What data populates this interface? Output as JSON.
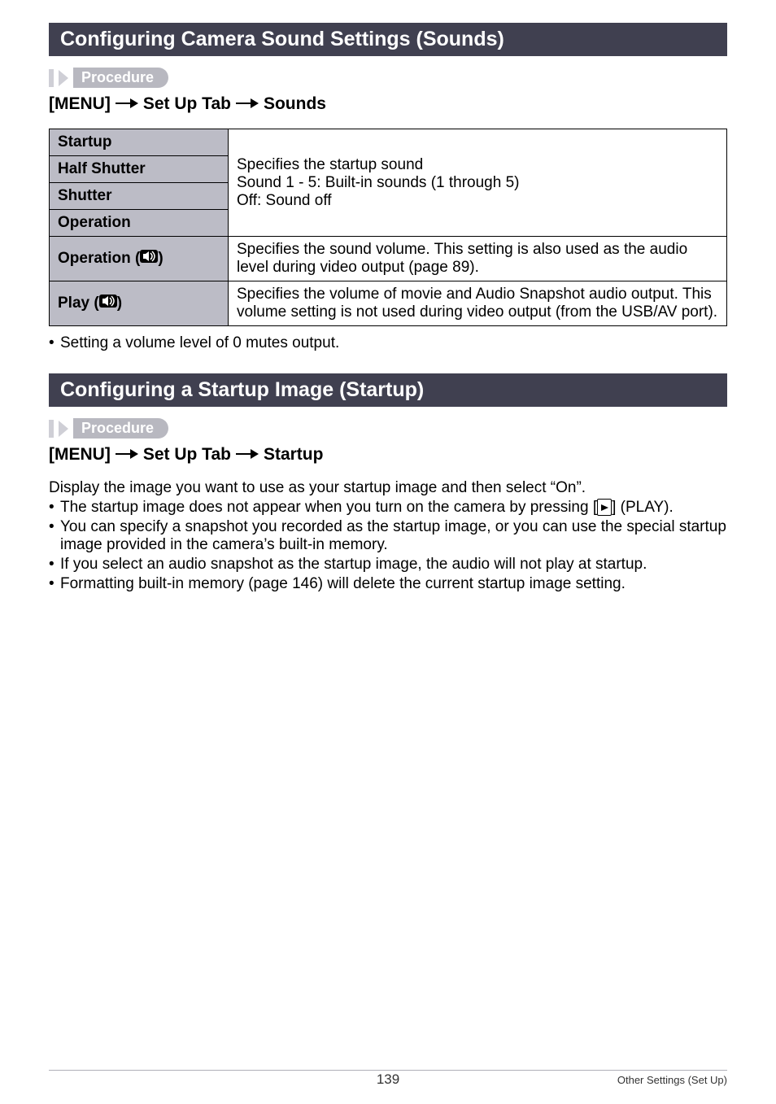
{
  "section1": {
    "title": "Configuring Camera Sound Settings (Sounds)",
    "procedure_label": "Procedure",
    "menu_path": {
      "p1": "[MENU]",
      "p2": "Set Up Tab",
      "p3": "Sounds"
    },
    "table": {
      "rows": [
        {
          "label": "Startup"
        },
        {
          "label": "Half Shutter"
        },
        {
          "label": "Shutter"
        },
        {
          "label": "Operation"
        }
      ],
      "desc_l1": "Specifies the startup sound",
      "desc_l2": "Sound 1 - 5: Built-in sounds (1 through 5)",
      "desc_l3": "Off: Sound off",
      "op_vol_label_pre": "Operation (",
      "op_vol_label_post": ")",
      "op_vol_desc": "Specifies the sound volume. This setting is also used as the audio level during video output (page 89).",
      "play_label_pre": "Play (",
      "play_label_post": ")",
      "play_desc": "Specifies the volume of movie and Audio Snapshot audio output. This volume setting is not used during video output (from the USB/AV port)."
    },
    "bullet1": "Setting a volume level of 0 mutes output."
  },
  "section2": {
    "title": "Configuring a Startup Image (Startup)",
    "procedure_label": "Procedure",
    "menu_path": {
      "p1": "[MENU]",
      "p2": "Set Up Tab",
      "p3": "Startup"
    },
    "intro": "Display the image you want to use as your startup image and then select “On”.",
    "b1_pre": "The startup image does not appear when you turn on the camera by pressing [",
    "b1_post": "] (PLAY).",
    "b2": "You can specify a snapshot you recorded as the startup image, or you can use the special startup image provided in the camera’s built-in memory.",
    "b3": "If you select an audio snapshot as the startup image, the audio will not play at startup.",
    "b4": "Formatting built-in memory (page 146) will delete the current startup image setting."
  },
  "footer": {
    "page": "139",
    "right": "Other Settings (Set Up)"
  }
}
